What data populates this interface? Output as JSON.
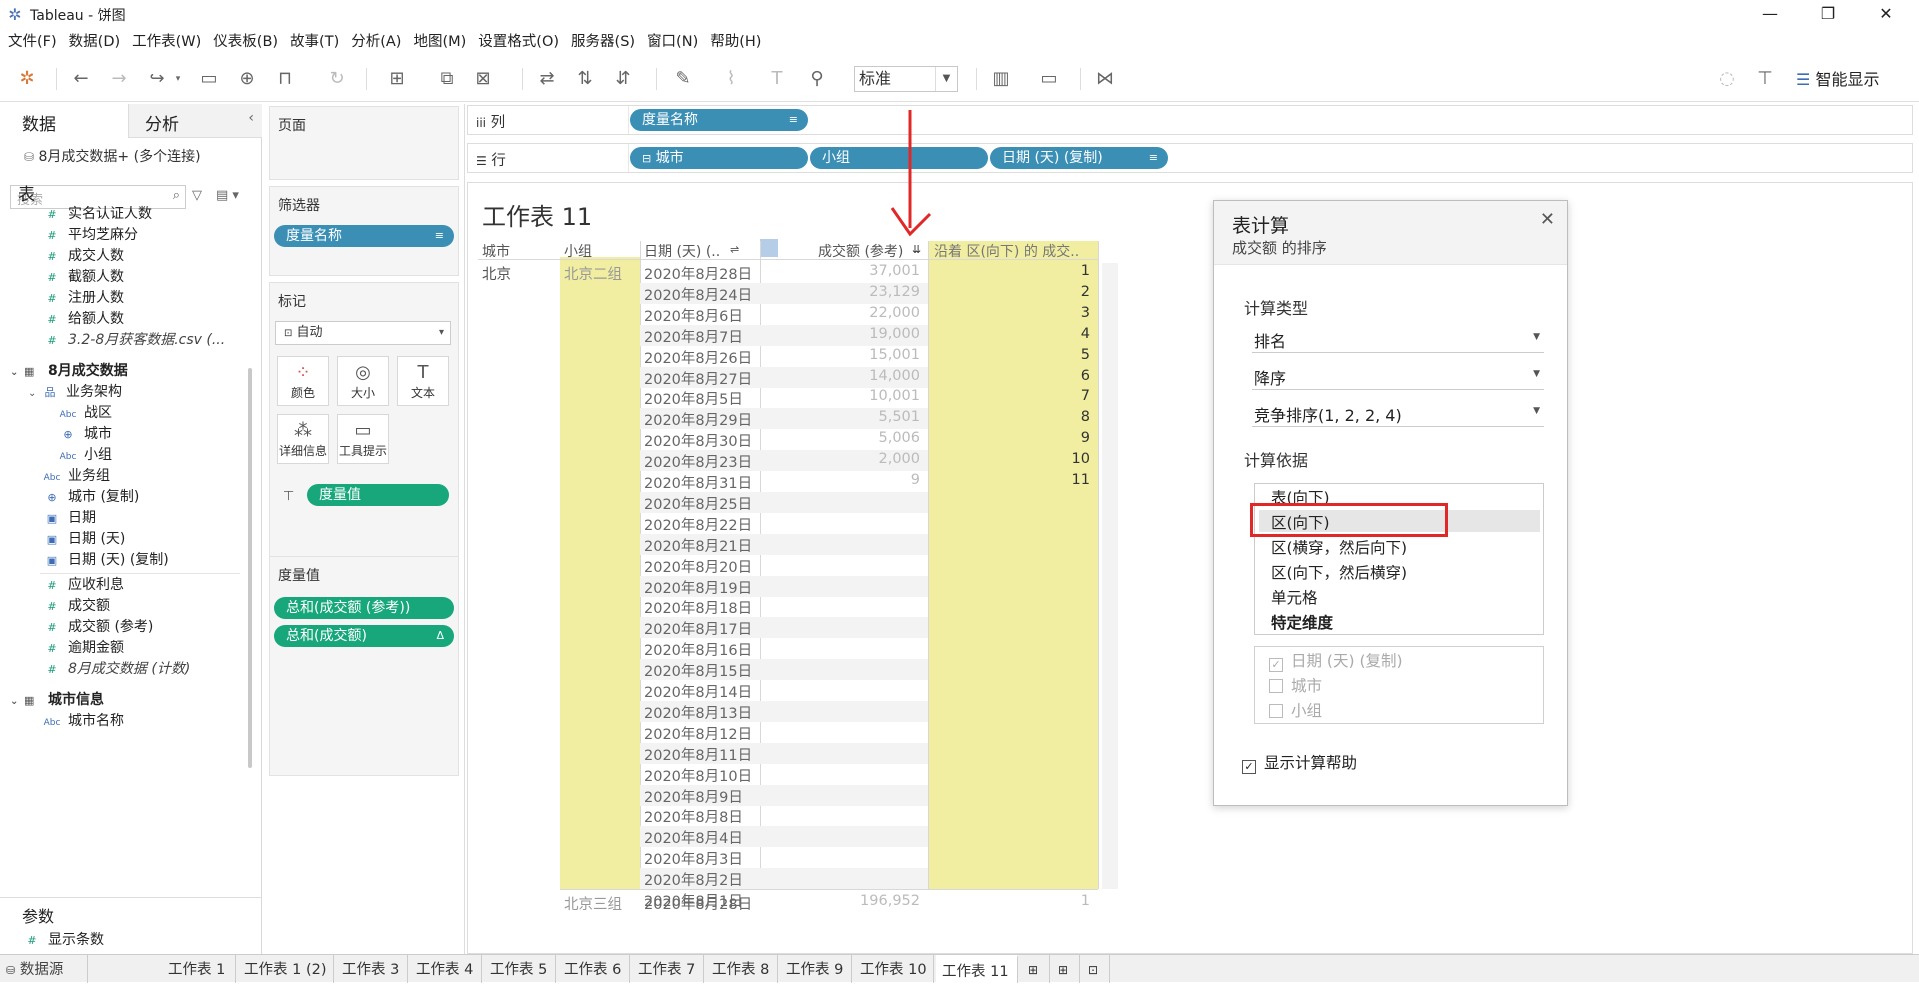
{
  "window": {
    "title": "Tableau - 饼图"
  },
  "menu": [
    "文件(F)",
    "数据(D)",
    "工作表(W)",
    "仪表板(B)",
    "故事(T)",
    "分析(A)",
    "地图(M)",
    "设置格式(O)",
    "服务器(S)",
    "窗口(N)",
    "帮助(H)"
  ],
  "toolbar": {
    "fit": "标准",
    "show_me": "智能显示"
  },
  "data_pane": {
    "tab_data": "数据",
    "tab_analysis": "分析",
    "datasource": "8月成交数据+ (多个连接)",
    "search_placeholder": "搜索",
    "section_table": "表",
    "fields_top": [
      "实名认证人数",
      "平均芝麻分",
      "成交人数",
      "截额人数",
      "注册人数",
      "给额人数"
    ],
    "italic_field": "3.2-8月获客数据.csv (...",
    "group1": "8月成交数据",
    "hier": "业务架构",
    "hier_items": [
      "战区",
      "城市",
      "小组"
    ],
    "dims": [
      "业务组",
      "城市 (复制)",
      "日期",
      "日期 (天)",
      "日期 (天) (复制)"
    ],
    "measures": [
      "应收利息",
      "成交额",
      "成交额 (参考)",
      "逾期金额"
    ],
    "count_field": "8月成交数据 (计数)",
    "group2": "城市信息",
    "group2_item": "城市名称",
    "params_header": "参数",
    "param": "显示条数"
  },
  "cards": {
    "pages": "页面",
    "filters": "筛选器",
    "filter_pill": "度量名称",
    "marks": "标记",
    "mark_type": "自动",
    "mark_buttons": [
      "颜色",
      "大小",
      "文本",
      "详细信息",
      "工具提示"
    ],
    "marks_pill": "度量值",
    "measure_values": "度量值",
    "mv_pills": [
      "总和(成交额 (参考))",
      "总和(成交额)"
    ]
  },
  "shelves": {
    "columns_label": "列",
    "rows_label": "行",
    "columns_pills": [
      "度量名称"
    ],
    "rows_pills": [
      "城市",
      "小组",
      "日期 (天) (复制)"
    ]
  },
  "view": {
    "title": "工作表 11",
    "headers": {
      "city": "城市",
      "group": "小组",
      "date": "日期 (天) (..",
      "amount": "成交额 (参考)",
      "rank": "沿着 区(向下) 的 成交.."
    },
    "city": "北京",
    "group1": "北京二组",
    "group2": "北京三组",
    "rows": [
      {
        "date": "2020年8月28日",
        "amount": "37,001",
        "rank": "1"
      },
      {
        "date": "2020年8月24日",
        "amount": "23,129",
        "rank": "2"
      },
      {
        "date": "2020年8月6日",
        "amount": "22,000",
        "rank": "3"
      },
      {
        "date": "2020年8月7日",
        "amount": "19,000",
        "rank": "4"
      },
      {
        "date": "2020年8月26日",
        "amount": "15,001",
        "rank": "5"
      },
      {
        "date": "2020年8月27日",
        "amount": "14,000",
        "rank": "6"
      },
      {
        "date": "2020年8月5日",
        "amount": "10,001",
        "rank": "7"
      },
      {
        "date": "2020年8月29日",
        "amount": "5,501",
        "rank": "8"
      },
      {
        "date": "2020年8月30日",
        "amount": "5,006",
        "rank": "9"
      },
      {
        "date": "2020年8月23日",
        "amount": "2,000",
        "rank": "10"
      },
      {
        "date": "2020年8月31日",
        "amount": "9",
        "rank": "11"
      },
      {
        "date": "2020年8月25日",
        "amount": "",
        "rank": ""
      },
      {
        "date": "2020年8月22日",
        "amount": "",
        "rank": ""
      },
      {
        "date": "2020年8月21日",
        "amount": "",
        "rank": ""
      },
      {
        "date": "2020年8月20日",
        "amount": "",
        "rank": ""
      },
      {
        "date": "2020年8月19日",
        "amount": "",
        "rank": ""
      },
      {
        "date": "2020年8月18日",
        "amount": "",
        "rank": ""
      },
      {
        "date": "2020年8月17日",
        "amount": "",
        "rank": ""
      },
      {
        "date": "2020年8月16日",
        "amount": "",
        "rank": ""
      },
      {
        "date": "2020年8月15日",
        "amount": "",
        "rank": ""
      },
      {
        "date": "2020年8月14日",
        "amount": "",
        "rank": ""
      },
      {
        "date": "2020年8月13日",
        "amount": "",
        "rank": ""
      },
      {
        "date": "2020年8月12日",
        "amount": "",
        "rank": ""
      },
      {
        "date": "2020年8月11日",
        "amount": "",
        "rank": ""
      },
      {
        "date": "2020年8月10日",
        "amount": "",
        "rank": ""
      },
      {
        "date": "2020年8月9日",
        "amount": "",
        "rank": ""
      },
      {
        "date": "2020年8月8日",
        "amount": "",
        "rank": ""
      },
      {
        "date": "2020年8月4日",
        "amount": "",
        "rank": ""
      },
      {
        "date": "2020年8月3日",
        "amount": "",
        "rank": ""
      },
      {
        "date": "2020年8月2日",
        "amount": "",
        "rank": ""
      },
      {
        "date": "2020年8月1日",
        "amount": "",
        "rank": ""
      }
    ],
    "group2_row": {
      "date": "2020年8月28日",
      "amount": "196,952",
      "rank": "1"
    }
  },
  "dialog": {
    "title": "表计算",
    "subtitle": "成交额 的排序",
    "calc_type_label": "计算类型",
    "calc_type": "排名",
    "order": "降序",
    "rank_mode": "竞争排序(1, 2, 2, 4)",
    "compute_using_label": "计算依据",
    "options": [
      "表(向下)",
      "区(向下)",
      "区(横穿，然后向下)",
      "区(向下，然后横穿)",
      "单元格",
      "特定维度"
    ],
    "dims": [
      "日期 (天) (复制)",
      "城市",
      "小组"
    ],
    "help": "显示计算帮助"
  },
  "bottom_tabs": [
    "数据源",
    "工作表 1",
    "工作表 1 (2)",
    "工作表 3",
    "工作表 4",
    "工作表 5",
    "工作表 6",
    "工作表 7",
    "工作表 8",
    "工作表 9",
    "工作表 10",
    "工作表 11"
  ],
  "colors": {
    "accent_green": "#17a77a",
    "pill_blue": "#3b8fb5",
    "highlight_yellow": "#f1eea1",
    "annotation_red": "#e12828"
  }
}
